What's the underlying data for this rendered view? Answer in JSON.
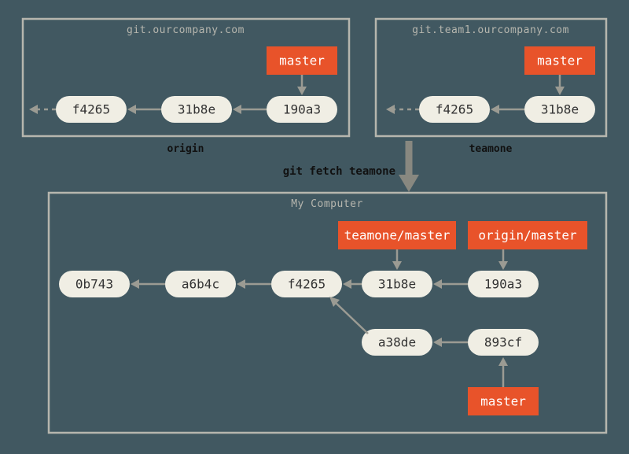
{
  "servers": {
    "origin": {
      "title": "git.ourcompany.com",
      "label": "origin",
      "branch": "master",
      "commits": [
        "f4265",
        "31b8e",
        "190a3"
      ]
    },
    "teamone": {
      "title": "git.team1.ourcompany.com",
      "label": "teamone",
      "branch": "master",
      "commits": [
        "f4265",
        "31b8e"
      ]
    }
  },
  "fetch_command": "git fetch teamone",
  "local": {
    "title": "My Computer",
    "commits_main": [
      "0b743",
      "a6b4c",
      "f4265",
      "31b8e",
      "190a3"
    ],
    "commits_branch": [
      "a38de",
      "893cf"
    ],
    "remote_refs": {
      "teamone_master": "teamone/master",
      "origin_master": "origin/master"
    },
    "local_branch": "master"
  },
  "colors": {
    "background": "#415861",
    "box_stroke": "#b6b6ae",
    "commit_fill": "#f0eee4",
    "branch_fill": "#e8532a",
    "arrow": "#9b9b93"
  }
}
